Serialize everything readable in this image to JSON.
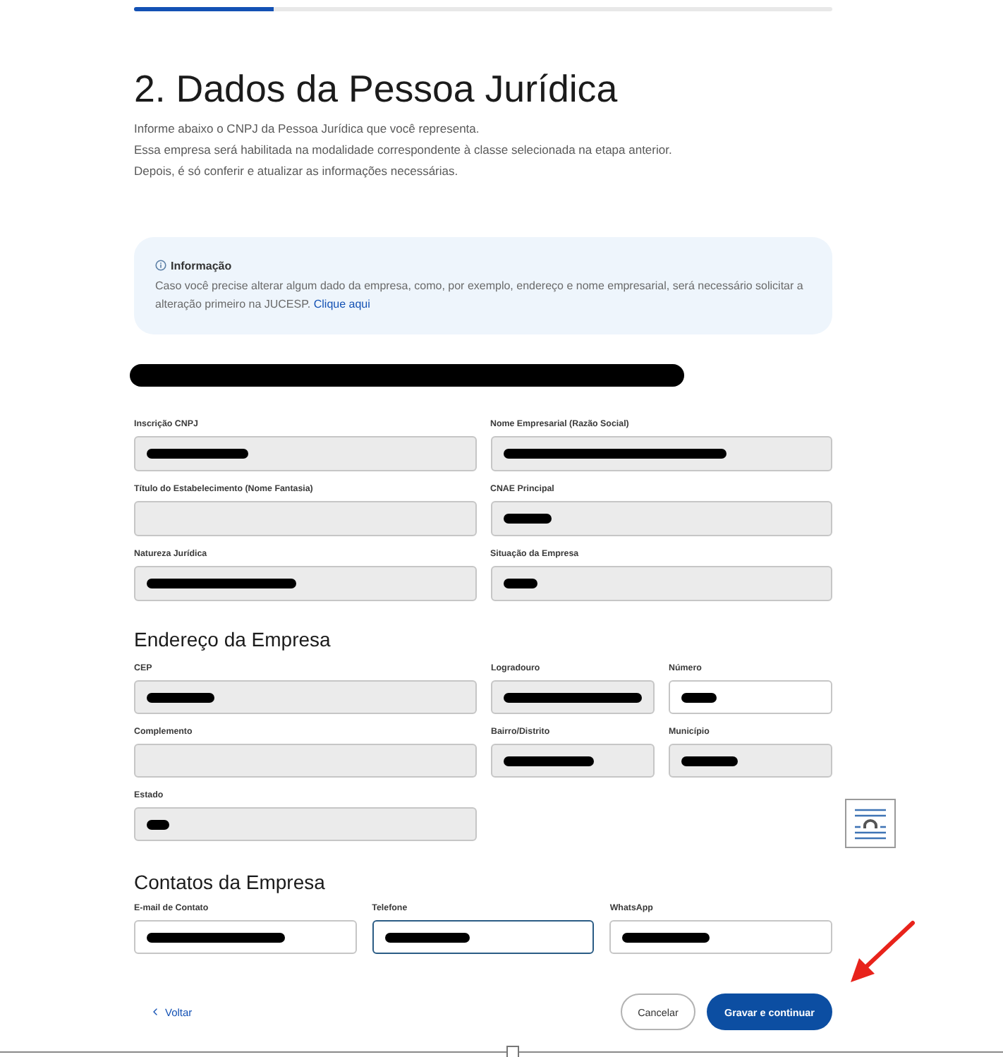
{
  "progress": {
    "level": 0.2
  },
  "header": {
    "title": "2. Dados da Pessoa Jurídica",
    "description": [
      "Informe abaixo o CNPJ da Pessoa Jurídica que você representa.",
      "Essa empresa será habilitada na modalidade correspondente à classe selecionada na etapa anterior.",
      "Depois, é só conferir e atualizar as informações necessárias."
    ]
  },
  "info_box": {
    "title": "Informação",
    "text": "Caso você precise alterar algum dado da empresa, como, por exemplo, endereço e nome empresarial, será necessário solicitar a alteração primeiro na JUCESP.",
    "link": "Clique aqui"
  },
  "company": {
    "name_redacted": true,
    "fields": [
      {
        "label": "Inscrição CNPJ",
        "disabled": true,
        "redacted": true
      },
      {
        "label": "Nome Empresarial (Razão Social)",
        "disabled": true,
        "redacted": true
      },
      {
        "label": "Título do Estabelecimento (Nome Fantasia)",
        "disabled": true,
        "redacted": false
      },
      {
        "label": "CNAE Principal",
        "disabled": true,
        "redacted": true
      },
      {
        "label": "Natureza Jurídica",
        "disabled": true,
        "redacted": true
      },
      {
        "label": "Situação da Empresa",
        "disabled": true,
        "redacted": true
      }
    ]
  },
  "address": {
    "heading": "Endereço da Empresa",
    "fields": [
      {
        "label": "CEP",
        "disabled": true,
        "redacted": true
      },
      {
        "label": "Logradouro",
        "disabled": true,
        "redacted": true
      },
      {
        "label": "Número",
        "disabled": false,
        "redacted": true
      },
      {
        "label": "Complemento",
        "disabled": true,
        "redacted": false
      },
      {
        "label": "Bairro/Distrito",
        "disabled": true,
        "redacted": true
      },
      {
        "label": "Município",
        "disabled": true,
        "redacted": true
      },
      {
        "label": "Estado",
        "disabled": true,
        "redacted": true
      }
    ]
  },
  "contacts": {
    "heading": "Contatos da Empresa",
    "fields": [
      {
        "label": "E-mail de Contato",
        "disabled": false,
        "focused": false,
        "redacted": true
      },
      {
        "label": "Telefone",
        "disabled": false,
        "focused": true,
        "redacted": true
      },
      {
        "label": "WhatsApp",
        "disabled": false,
        "focused": false,
        "redacted": true
      }
    ]
  },
  "actions": {
    "back": "Voltar",
    "cancel": "Cancelar",
    "submit": "Gravar e continuar"
  }
}
